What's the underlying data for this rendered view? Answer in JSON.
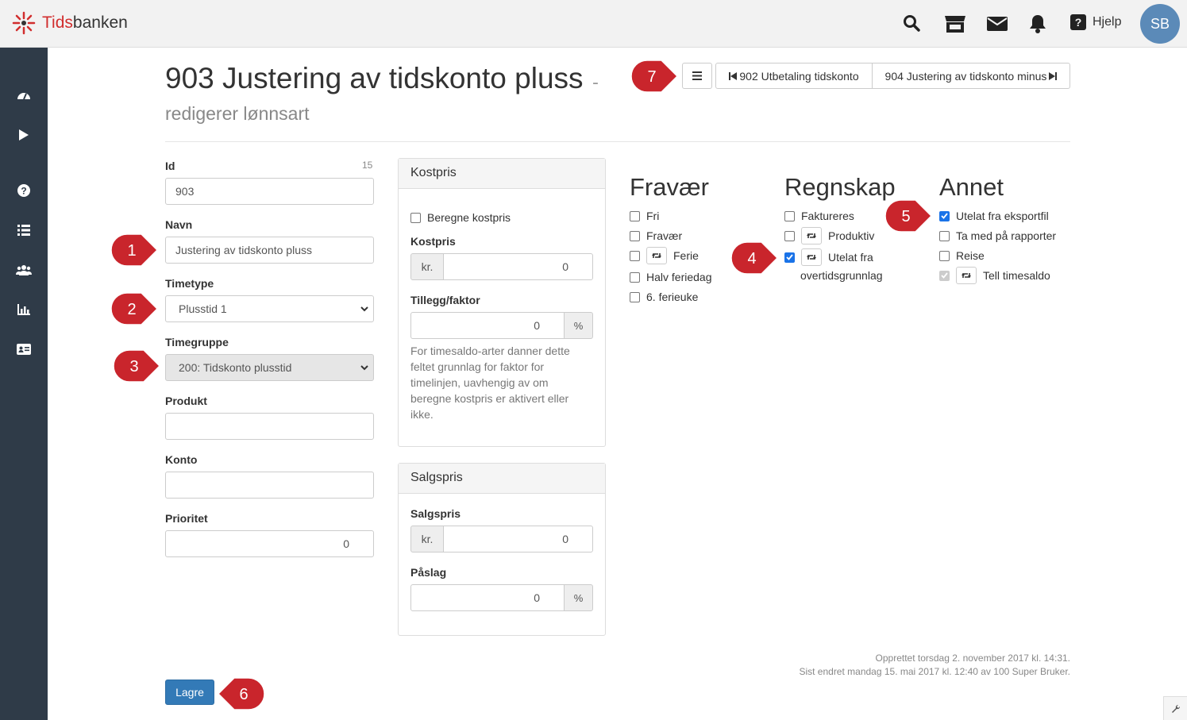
{
  "header": {
    "brand_prefix": "Tids",
    "brand_suffix": "banken",
    "help_label": "Hjelp",
    "avatar_initials": "SB",
    "icons": [
      "search-icon",
      "store-icon",
      "mail-icon",
      "bell-icon",
      "question-icon"
    ]
  },
  "sidebar": {
    "icons": [
      "dashboard-icon",
      "play-icon",
      "help-icon",
      "list-icon",
      "users-icon",
      "chart-icon",
      "id-card-icon"
    ]
  },
  "page": {
    "title": "903 Justering av tidskonto pluss",
    "title_dash": "-",
    "subtitle": "redigerer lønnsart"
  },
  "nav": {
    "prev_label": "902 Utbetaling tidskonto",
    "next_label": "904 Justering av tidskonto minus"
  },
  "form": {
    "id_label": "Id",
    "id_count": "15",
    "id_value": "903",
    "navn_label": "Navn",
    "navn_value": "Justering av tidskonto pluss",
    "timetype_label": "Timetype",
    "timetype_value": "Plusstid 1",
    "timegruppe_label": "Timegruppe",
    "timegruppe_value": "200: Tidskonto plusstid",
    "produkt_label": "Produkt",
    "produkt_value": "",
    "konto_label": "Konto",
    "konto_value": "",
    "prioritet_label": "Prioritet",
    "prioritet_value": "0"
  },
  "kostpris": {
    "title": "Kostpris",
    "beregne_label": "Beregne kostpris",
    "kostpris_label": "Kostpris",
    "currency": "kr.",
    "kostpris_value": "0",
    "tillegg_label": "Tillegg/faktor",
    "tillegg_value": "0",
    "percent": "%",
    "help_lines": [
      "For timesaldo-arter danner dette",
      "feltet grunnlag for faktor for",
      "timelinjen, uavhengig av om",
      "beregne kostpris er aktivert eller",
      "ikke."
    ]
  },
  "salgspris": {
    "title": "Salgspris",
    "salgspris_label": "Salgspris",
    "currency": "kr.",
    "salgspris_value": "0",
    "paslag_label": "Påslag",
    "paslag_value": "0",
    "percent": "%"
  },
  "fravaer": {
    "title": "Fravær",
    "items": [
      {
        "label": "Fri",
        "checked": false
      },
      {
        "label": "Fravær",
        "checked": false
      },
      {
        "label": "Ferie",
        "checked": false
      },
      {
        "label": "Halv feriedag",
        "checked": false
      },
      {
        "label": "6. ferieuke",
        "checked": false
      }
    ]
  },
  "regnskap": {
    "title": "Regnskap",
    "items": [
      {
        "label": "Faktureres",
        "checked": false
      },
      {
        "label": "Produktiv",
        "checked": false
      },
      {
        "label": "Utelat fra",
        "label2": "overtidsgrunnlag",
        "checked": true
      }
    ]
  },
  "annet": {
    "title": "Annet",
    "items": [
      {
        "label": "Utelat fra eksportfil",
        "checked": true
      },
      {
        "label": "Ta med på rapporter",
        "checked": false
      },
      {
        "label": "Reise",
        "checked": false
      },
      {
        "label": "Tell timesaldo",
        "checked": true,
        "disabled": true
      }
    ]
  },
  "meta": {
    "created": "Opprettet torsdag 2. november 2017 kl. 14:31.",
    "modified": "Sist endret mandag 15. mai 2017 kl. 12:40 av 100 Super Bruker."
  },
  "save_label": "Lagre",
  "badges": [
    "1",
    "2",
    "3",
    "4",
    "5",
    "6",
    "7"
  ],
  "colors": {
    "badge": "#c9252c",
    "primary": "#337ab7",
    "sidebar": "#2f3b48"
  }
}
